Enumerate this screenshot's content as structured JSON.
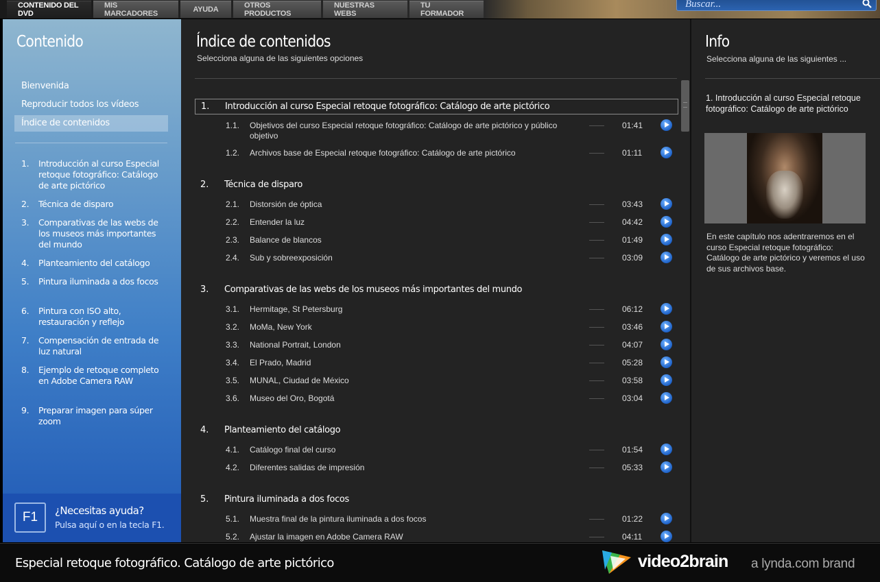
{
  "tabs": [
    {
      "label": "CONTENIDO DEL DVD",
      "active": true
    },
    {
      "label": "MIS MARCADORES",
      "active": false
    },
    {
      "label": "AYUDA",
      "active": false
    },
    {
      "label": "OTROS PRODUCTOS",
      "active": false
    },
    {
      "label": "NUESTRAS WEBS",
      "active": false
    },
    {
      "label": "TU FORMADOR",
      "active": false
    }
  ],
  "search": {
    "placeholder": "Buscar...",
    "icon": "magnifier-icon"
  },
  "sidebar": {
    "title": "Contenido",
    "nav": [
      {
        "label": "Bienvenida"
      },
      {
        "label": "Reproducir todos los vídeos"
      },
      {
        "label": "Índice de contenidos",
        "selected": true
      }
    ],
    "chapters": [
      {
        "num": "1.",
        "title": "Introducción al curso Especial retoque fotográfico: Catálogo de arte pictórico"
      },
      {
        "num": "2.",
        "title": "Técnica de disparo"
      },
      {
        "num": "3.",
        "title": "Comparativas de las webs de los museos más importantes del mundo"
      },
      {
        "num": "4.",
        "title": "Planteamiento del catálogo"
      },
      {
        "num": "5.",
        "title": "Pintura iluminada a dos focos"
      },
      {
        "num": "6.",
        "title": "Pintura con ISO alto, restauración y reflejo"
      },
      {
        "num": "7.",
        "title": "Compensación de entrada de luz natural"
      },
      {
        "num": "8.",
        "title": "Ejemplo de retoque completo en Adobe Camera RAW"
      },
      {
        "num": "9.",
        "title": "Preparar imagen para súper zoom"
      }
    ],
    "help": {
      "key": "F1",
      "title": "¿Necesitas ayuda?",
      "subtitle": "Pulsa aquí o en la tecla F1."
    }
  },
  "main": {
    "title": "Índice de contenidos",
    "subtitle": "Selecciona alguna de las siguientes opciones",
    "sections": [
      {
        "num": "1.",
        "title": "Introducción al curso Especial retoque fotográfico: Catálogo de arte pictórico",
        "selected": true,
        "lessons": [
          {
            "num": "1.1.",
            "title": "Objetivos del curso Especial retoque fotográfico: Catálogo de arte pictórico y público objetivo",
            "duration": "01:41"
          },
          {
            "num": "1.2.",
            "title": "Archivos base de Especial retoque fotográfico: Catálogo de arte pictórico",
            "duration": "01:11"
          }
        ]
      },
      {
        "num": "2.",
        "title": "Técnica de disparo",
        "lessons": [
          {
            "num": "2.1.",
            "title": "Distorsión de óptica",
            "duration": "03:43"
          },
          {
            "num": "2.2.",
            "title": "Entender la luz",
            "duration": "04:42"
          },
          {
            "num": "2.3.",
            "title": "Balance de blancos",
            "duration": "01:49"
          },
          {
            "num": "2.4.",
            "title": "Sub y sobreexposición",
            "duration": "03:09"
          }
        ]
      },
      {
        "num": "3.",
        "title": "Comparativas de las webs de los museos más importantes del mundo",
        "lessons": [
          {
            "num": "3.1.",
            "title": "Hermitage, St Petersburg",
            "duration": "06:12"
          },
          {
            "num": "3.2.",
            "title": "MoMa, New York",
            "duration": "03:46"
          },
          {
            "num": "3.3.",
            "title": "National Portrait, London",
            "duration": "04:07"
          },
          {
            "num": "3.4.",
            "title": "El Prado, Madrid",
            "duration": "05:28"
          },
          {
            "num": "3.5.",
            "title": "MUNAL, Ciudad de México",
            "duration": "03:58"
          },
          {
            "num": "3.6.",
            "title": "Museo del Oro, Bogotá",
            "duration": "03:04"
          }
        ]
      },
      {
        "num": "4.",
        "title": "Planteamiento del catálogo",
        "lessons": [
          {
            "num": "4.1.",
            "title": "Catálogo final del curso",
            "duration": "01:54"
          },
          {
            "num": "4.2.",
            "title": "Diferentes salidas de impresión",
            "duration": "05:33"
          }
        ]
      },
      {
        "num": "5.",
        "title": "Pintura iluminada a dos focos",
        "lessons": [
          {
            "num": "5.1.",
            "title": "Muestra final de la pintura iluminada a dos focos",
            "duration": "01:22"
          },
          {
            "num": "5.2.",
            "title": "Ajustar la imagen en Adobe Camera RAW",
            "duration": "04:11"
          }
        ]
      }
    ]
  },
  "info": {
    "title": "Info",
    "subtitle": "Selecciona alguna de las siguientes ...",
    "item_title": "1. Introducción al curso Especial retoque fotográfico: Catálogo de arte pictórico",
    "description": "En este capítulo nos adentraremos en el curso Especial retoque fotográfico: Catálogo de arte pictórico y veremos el uso de sus archivos base."
  },
  "footer": {
    "course_title": "Especial retoque fotográfico. Catálogo de arte pictórico",
    "brand": "video2brain",
    "tagline": "a lynda.com brand"
  },
  "colors": {
    "accent": "#1f63c9",
    "sidebar_top": "#8fb6cf",
    "sidebar_bottom": "#1f58b5",
    "panel_bg": "#232323"
  }
}
